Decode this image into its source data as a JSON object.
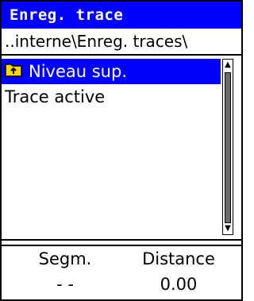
{
  "window": {
    "title": "Enreg. trace"
  },
  "path": {
    "text": "..interne\\Enreg. traces\\"
  },
  "list": {
    "items": [
      {
        "label": "Niveau sup.",
        "icon": "folder-up-icon",
        "selected": true
      },
      {
        "label": "Trace active",
        "icon": "",
        "selected": false
      }
    ]
  },
  "footer": {
    "columns": [
      {
        "label": "Segm.",
        "value": "- -"
      },
      {
        "label": "Distance",
        "value": "0.00"
      }
    ]
  },
  "colors": {
    "accent": "#0000ff",
    "accent_text": "#ffffff",
    "text": "#000000",
    "background": "#ffffff",
    "folder_icon": "#ffd700"
  }
}
